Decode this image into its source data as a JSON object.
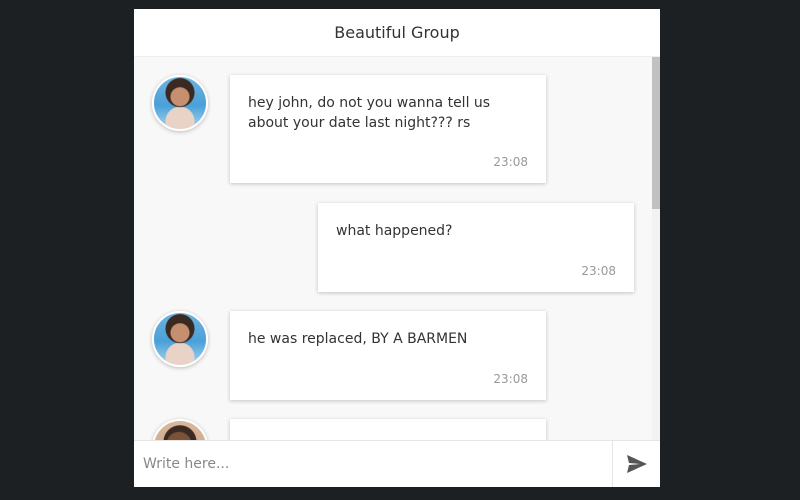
{
  "chat": {
    "title": "Beautiful Group",
    "messages": [
      {
        "text": "hey john, do not you wanna tell us about your date last night??? rs",
        "time": "23:08"
      },
      {
        "text": "what happened?",
        "time": "23:08"
      },
      {
        "text": "he was replaced, BY A BARMEN",
        "time": "23:08"
      },
      {
        "text": "",
        "time": ""
      }
    ]
  },
  "composer": {
    "placeholder": "Write here...",
    "value": ""
  },
  "icons": {
    "send": "send-icon"
  },
  "colors": {
    "page_background": "#1d2023",
    "chat_background": "#f8f8f8",
    "bubble_background": "#ffffff",
    "send_icon": "#555555"
  }
}
